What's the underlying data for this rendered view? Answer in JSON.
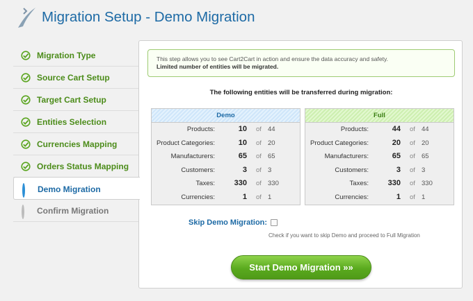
{
  "header": {
    "title": "Migration Setup - Demo Migration",
    "logo_icon": "cart2cart-logo"
  },
  "sidebar": {
    "steps": [
      {
        "label": "Migration Type",
        "state": "done"
      },
      {
        "label": "Source Cart Setup",
        "state": "done"
      },
      {
        "label": "Target Cart Setup",
        "state": "done"
      },
      {
        "label": "Entities Selection",
        "state": "done"
      },
      {
        "label": "Currencies Mapping",
        "state": "done"
      },
      {
        "label": "Orders Status Mapping",
        "state": "done"
      },
      {
        "label": "Demo Migration",
        "state": "current"
      },
      {
        "label": "Confirm Migration",
        "state": "pending"
      }
    ]
  },
  "notice": {
    "line1": "This step allows you to see Cart2Cart in action and ensure the data accuracy and safety.",
    "line2": "Limited number of entities will be migrated."
  },
  "entities_title": "The following entities will be transferred during migration:",
  "of_label": "of",
  "demo_table": {
    "header": "Demo",
    "rows": [
      {
        "name": "Products:",
        "count": "10",
        "total": "44"
      },
      {
        "name": "Product Categories:",
        "count": "10",
        "total": "20"
      },
      {
        "name": "Manufacturers:",
        "count": "65",
        "total": "65"
      },
      {
        "name": "Customers:",
        "count": "3",
        "total": "3"
      },
      {
        "name": "Taxes:",
        "count": "330",
        "total": "330"
      },
      {
        "name": "Currencies:",
        "count": "1",
        "total": "1"
      }
    ]
  },
  "full_table": {
    "header": "Full",
    "rows": [
      {
        "name": "Products:",
        "count": "44",
        "total": "44"
      },
      {
        "name": "Product Categories:",
        "count": "20",
        "total": "20"
      },
      {
        "name": "Manufacturers:",
        "count": "65",
        "total": "65"
      },
      {
        "name": "Customers:",
        "count": "3",
        "total": "3"
      },
      {
        "name": "Taxes:",
        "count": "330",
        "total": "330"
      },
      {
        "name": "Currencies:",
        "count": "1",
        "total": "1"
      }
    ]
  },
  "skip": {
    "label": "Skip Demo Migration:",
    "checked": false,
    "hint": "Check if you want to skip Demo and proceed to Full Migration"
  },
  "start_button": {
    "label": "Start Demo Migration »»"
  },
  "colors": {
    "accent_blue": "#1d6aa5",
    "done_green": "#4c8c1a",
    "button_green": "#5aaa1e"
  }
}
